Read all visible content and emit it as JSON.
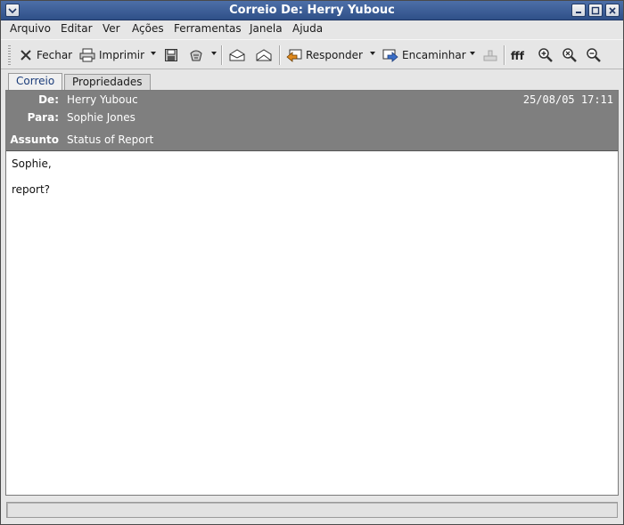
{
  "window": {
    "title": "Correio De: Herry Yubouc"
  },
  "menubar": {
    "items": [
      "Arquivo",
      "Editar",
      "Ver",
      "Ações",
      "Ferramentas",
      "Janela",
      "Ajuda"
    ]
  },
  "toolbar": {
    "close_label": "Fechar",
    "print_label": "Imprimir",
    "reply_label": "Responder",
    "forward_label": "Encaminhar"
  },
  "tabs": [
    {
      "label": "Correio",
      "active": true
    },
    {
      "label": "Propriedades",
      "active": false
    }
  ],
  "message": {
    "from_label": "De:",
    "from": "Herry Yubouc",
    "to_label": "Para:",
    "to": "Sophie Jones",
    "subject_label": "Assunto",
    "subject": "Status of Report",
    "date": "25/08/05 17:11",
    "body_lines": [
      "Sophie,",
      "report?"
    ]
  },
  "colors": {
    "titlebar": "#3a5d97",
    "header_bg": "#7f7f7f",
    "window_bg": "#e6e6e6"
  },
  "icons": [
    "menu-icon",
    "minimize-icon",
    "maximize-icon",
    "close-icon",
    "close-x-icon",
    "printer-icon",
    "save-icon",
    "junk-icon",
    "mark-read-icon",
    "mark-unread-icon",
    "reply-icon",
    "forward-icon",
    "meeting-icon",
    "font-icon",
    "zoom-in-icon",
    "zoom-normal-icon",
    "zoom-out-icon"
  ]
}
